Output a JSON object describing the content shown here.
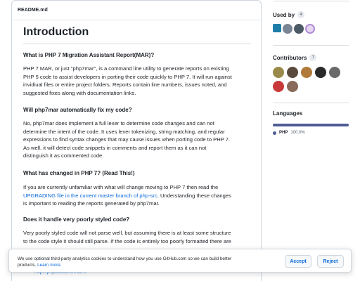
{
  "readme": {
    "filename": "README.md",
    "h1": "Introduction",
    "sections": [
      {
        "heading": "What is PHP 7 Migration Assistant Report(MAR)?",
        "lines": [
          "PHP 7 MAR, or just \"php7mar\", is a command line utility to generate reports on existing",
          "PHP 5 code to assist developers in porting their code quickly to PHP 7. It will run against",
          "invidiual files or entire project folders. Reports contain line numbers, issues noted, and",
          "suggested fixes along with documentation links."
        ]
      },
      {
        "heading": "Will php7mar automatically fix my code?",
        "lines": [
          "No, php7mar does implement a full lexer to determine code changes and can not",
          "determine the intent of the code. It uses lexer tokenizing, string matching, and regular",
          "expressions to find syntax changes that may cause issues when porting code to PHP 7.",
          "As well, it will detect code snippets in comments and report them as it can not",
          "distinguish it as commented code."
        ]
      },
      {
        "heading": "What has changed in PHP 7? (Read This!)",
        "line1": "If you are currently unfamiliar with what will change moving to PHP 7 then read the",
        "link": "UPGRADING file in the current master branch of php-src",
        "line2_rest": ". Understanding these changes",
        "line3": "is important to reading the reports generated by php7mar."
      },
      {
        "heading": "Does it handle very poorly styled code?",
        "lines": [
          "Very poorly styled code will not parse well, but assuming there is at least some structure",
          "to the code style it should still parse. If the code is entirely too poorly formatted there are"
        ],
        "link": "http://phpbeautifier.com/"
      }
    ]
  },
  "sidebar": {
    "used_by": {
      "title": "Used by",
      "count": "4"
    },
    "contributors": {
      "title": "Contributors",
      "count": "7"
    },
    "languages": {
      "title": "Languages",
      "name": "PHP",
      "percent": "100.0%",
      "color": "#4f5d95"
    }
  },
  "cookie": {
    "line1": "We use optional third-party analytics cookies to understand how you use GitHub.com so we can build better",
    "line2_prefix": "products.",
    "learn_more": "Learn more.",
    "accept_label": "Accept",
    "reject_label": "Reject"
  }
}
